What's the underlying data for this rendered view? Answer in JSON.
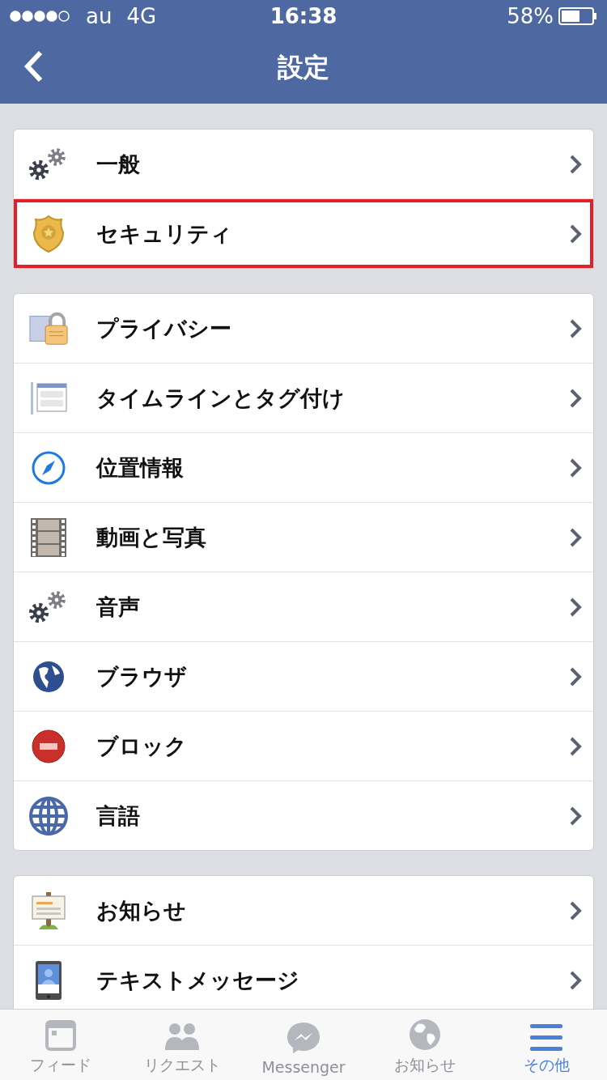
{
  "status_bar": {
    "carrier": "au",
    "network": "4G",
    "time": "16:38",
    "battery": "58%"
  },
  "nav": {
    "title": "設定"
  },
  "groups": [
    {
      "items": [
        {
          "label": "一般",
          "highlighted": false
        },
        {
          "label": "セキュリティ",
          "highlighted": true
        }
      ]
    },
    {
      "items": [
        {
          "label": "プライバシー",
          "highlighted": false
        },
        {
          "label": "タイムラインとタグ付け",
          "highlighted": false
        },
        {
          "label": "位置情報",
          "highlighted": false
        },
        {
          "label": "動画と写真",
          "highlighted": false
        },
        {
          "label": "音声",
          "highlighted": false
        },
        {
          "label": "ブラウザ",
          "highlighted": false
        },
        {
          "label": "ブロック",
          "highlighted": false
        },
        {
          "label": "言語",
          "highlighted": false
        }
      ]
    },
    {
      "items": [
        {
          "label": "お知らせ",
          "highlighted": false
        },
        {
          "label": "テキストメッセージ",
          "highlighted": false
        }
      ]
    }
  ],
  "tab_bar": [
    {
      "label": "フィード",
      "selected": false
    },
    {
      "label": "リクエスト",
      "selected": false
    },
    {
      "label": "Messenger",
      "selected": false
    },
    {
      "label": "お知らせ",
      "selected": false
    },
    {
      "label": "その他",
      "selected": true
    }
  ]
}
